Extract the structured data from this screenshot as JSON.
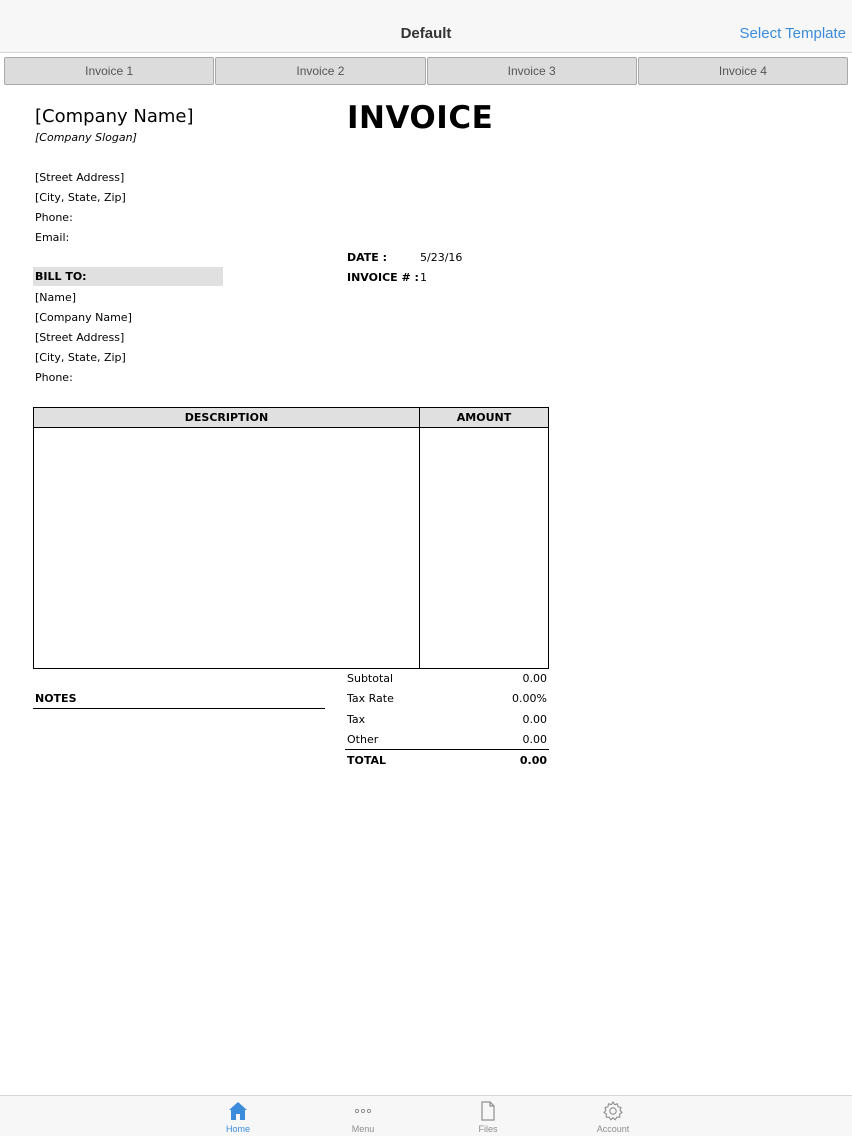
{
  "navbar": {
    "title": "Default",
    "action_label": "Select Template"
  },
  "tabs": [
    {
      "label": "Invoice 1"
    },
    {
      "label": "Invoice 2"
    },
    {
      "label": "Invoice 3"
    },
    {
      "label": "Invoice 4"
    }
  ],
  "invoice": {
    "title": "INVOICE",
    "company": {
      "name": "[Company Name]",
      "slogan": "[Company Slogan]",
      "street": "[Street Address]",
      "city": "[City, State,  Zip]",
      "phone": "Phone:",
      "email": "Email:"
    },
    "date_label": "DATE :",
    "date_value": "5/23/16",
    "number_label": "INVOICE # :",
    "number_value": "1",
    "bill_to": {
      "label": "BILL TO:",
      "name": "[Name]",
      "company": "[Company Name]",
      "street": "[Street Address]",
      "city": "[City, State,  Zip]",
      "phone": "Phone:"
    },
    "table": {
      "description_header": "DESCRIPTION",
      "amount_header": "AMOUNT"
    },
    "notes_label": "NOTES",
    "totals": {
      "subtotal_label": "Subtotal",
      "subtotal_value": "0.00",
      "tax_rate_label": "Tax Rate",
      "tax_rate_value": "0.00%",
      "tax_label": "Tax",
      "tax_value": "0.00",
      "other_label": "Other",
      "other_value": "0.00",
      "total_label": "TOTAL",
      "total_value": "0.00"
    }
  },
  "bottom_tabs": [
    {
      "label": "Home",
      "icon": "home-icon",
      "active": true
    },
    {
      "label": "Menu",
      "icon": "more-icon",
      "active": false
    },
    {
      "label": "Files",
      "icon": "file-icon",
      "active": false
    },
    {
      "label": "Account",
      "icon": "gear-icon",
      "active": false
    }
  ],
  "colors": {
    "accent": "#3b8ddb",
    "inactive": "#8e8e8e",
    "header_fill": "#e0e0e0"
  }
}
